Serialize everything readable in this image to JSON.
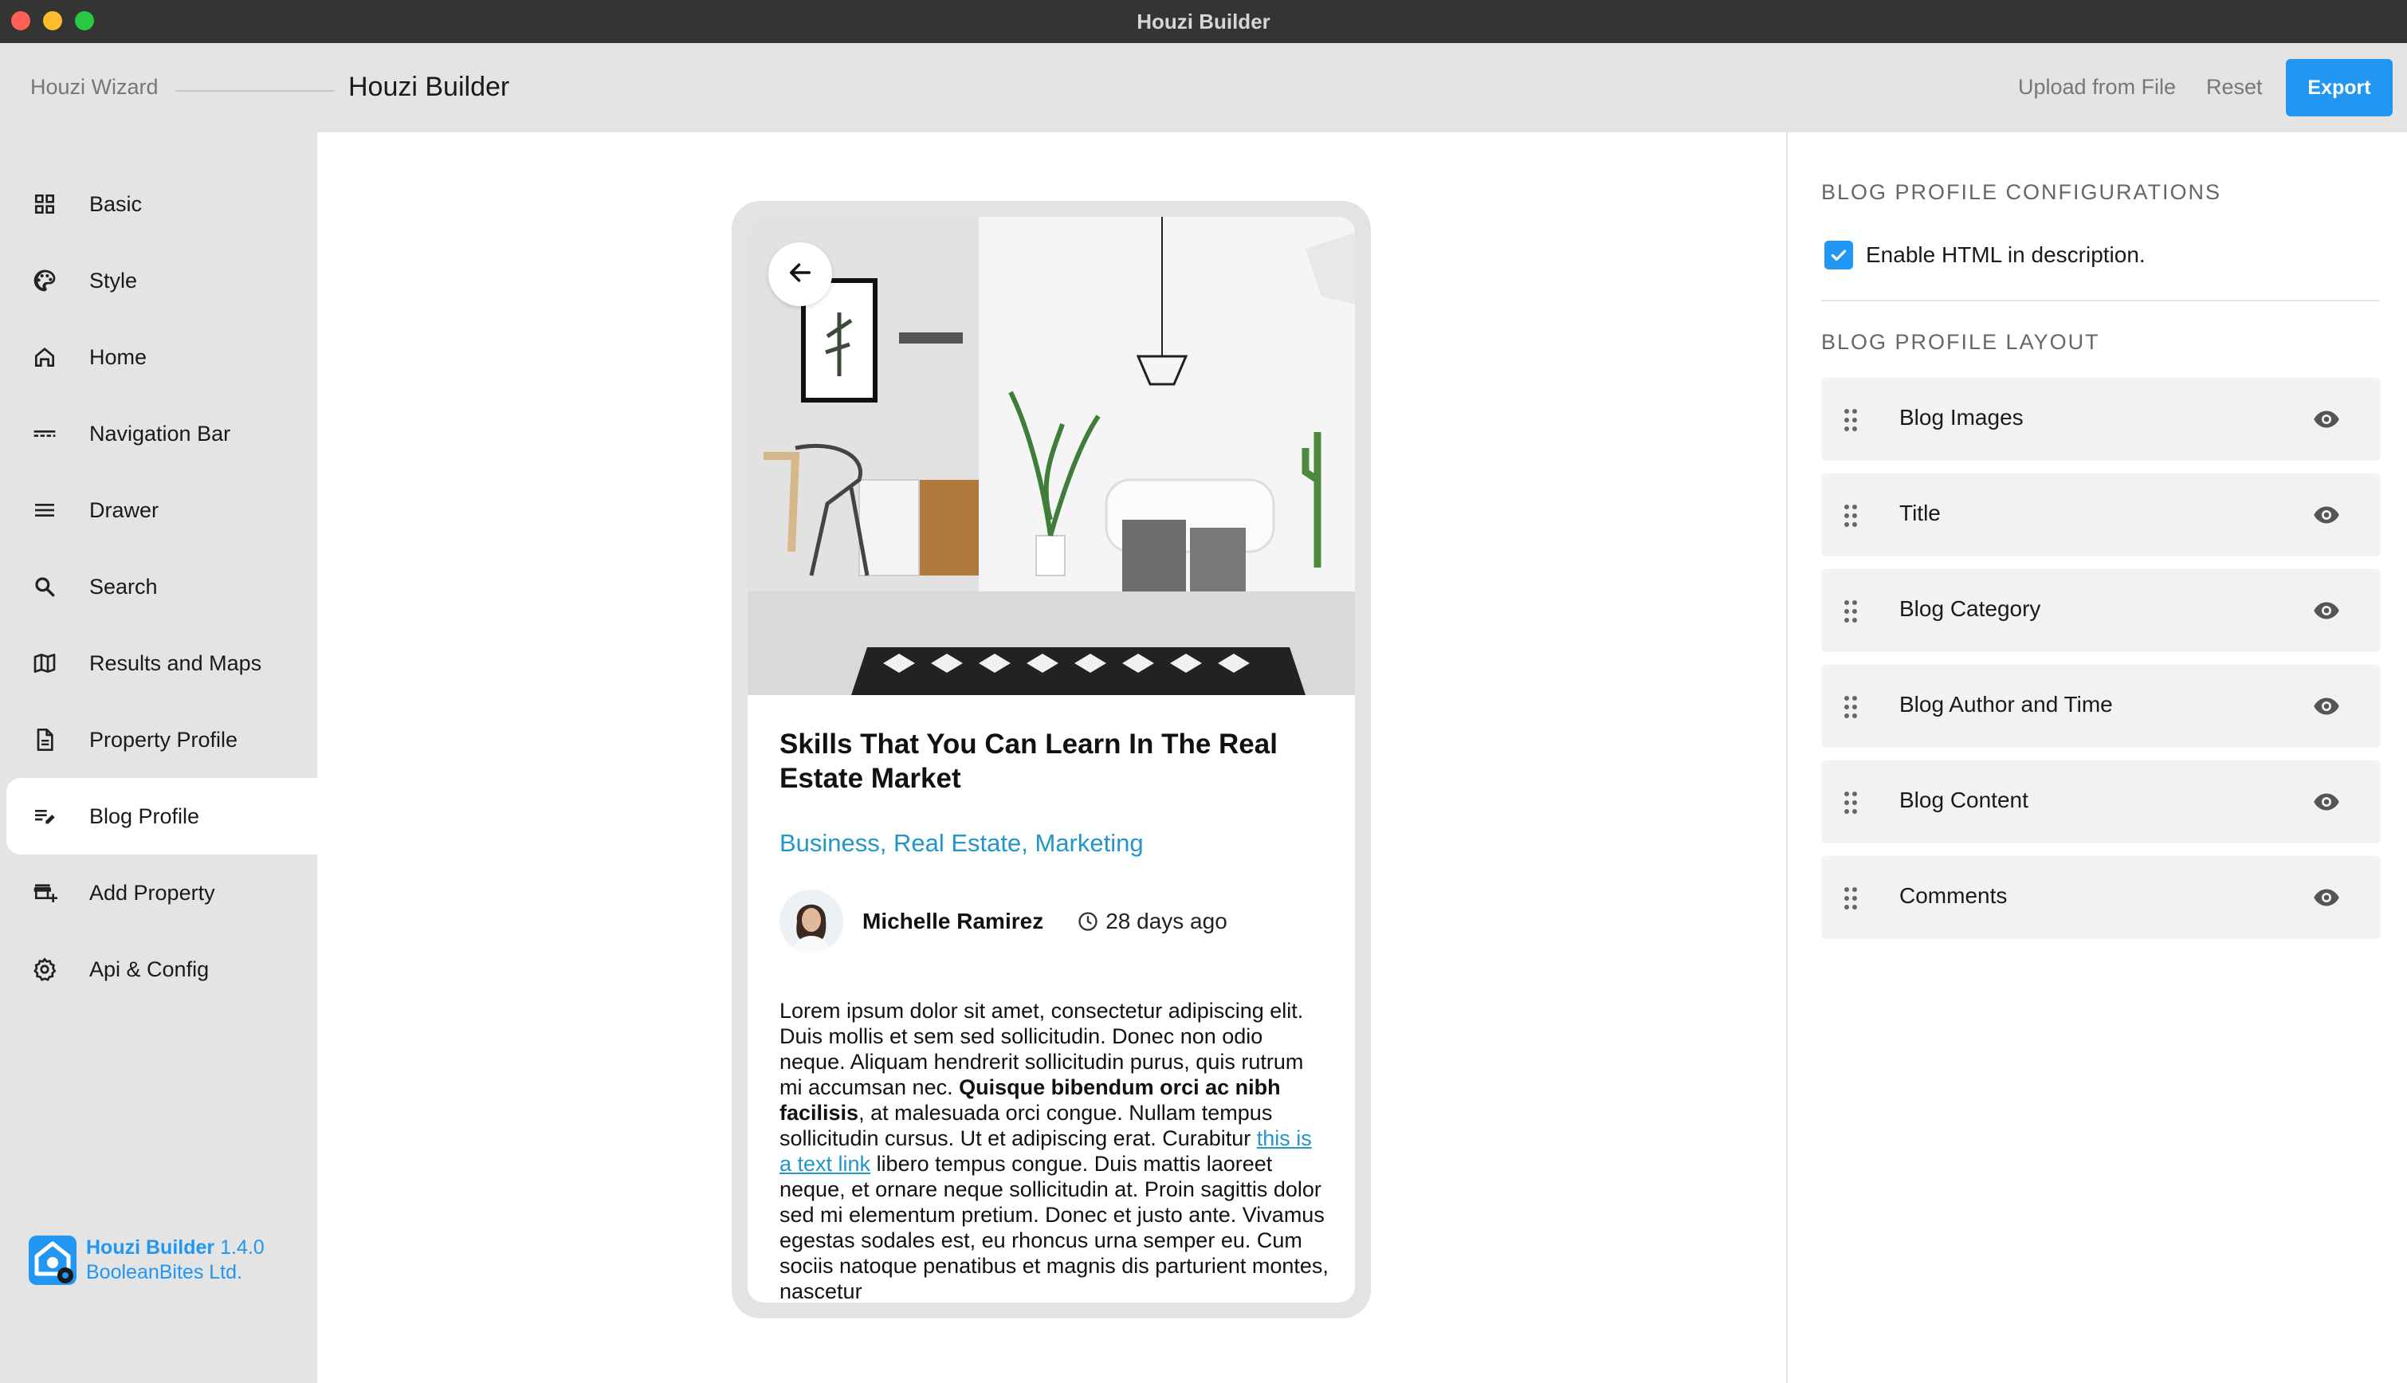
{
  "window": {
    "title": "Houzi Builder"
  },
  "header": {
    "crumb_wizard": "Houzi Wizard",
    "crumb_builder": "Houzi Builder",
    "upload_label": "Upload from File",
    "reset_label": "Reset",
    "export_label": "Export"
  },
  "sidebar": {
    "items": [
      {
        "label": "Basic",
        "icon": "grid-icon"
      },
      {
        "label": "Style",
        "icon": "palette-icon"
      },
      {
        "label": "Home",
        "icon": "home-icon"
      },
      {
        "label": "Navigation Bar",
        "icon": "navigation-bar-icon"
      },
      {
        "label": "Drawer",
        "icon": "menu-icon"
      },
      {
        "label": "Search",
        "icon": "search-icon"
      },
      {
        "label": "Results and Maps",
        "icon": "map-icon"
      },
      {
        "label": "Property Profile",
        "icon": "document-icon"
      },
      {
        "label": "Blog Profile",
        "icon": "edit-note-icon",
        "active": true
      },
      {
        "label": "Add Property",
        "icon": "add-business-icon"
      },
      {
        "label": "Api & Config",
        "icon": "gear-icon"
      }
    ],
    "brand": {
      "name": "Houzi Builder",
      "version": "1.4.0",
      "company": "BooleanBites Ltd."
    }
  },
  "preview": {
    "title": "Skills That You Can Learn In The Real Estate Market",
    "categories": "Business, Real Estate, Marketing",
    "author": "Michelle Ramirez",
    "time": "28 days ago",
    "body": {
      "p1": "Lorem ipsum dolor sit amet, consectetur adipiscing elit. Duis mollis et sem sed sollicitudin. Donec non odio neque. Aliquam hendrerit sollicitudin purus, quis rutrum mi accumsan nec. ",
      "bold": "Quisque bibendum orci ac nibh facilisis",
      "p2": ", at malesuada orci congue. Nullam tempus sollicitudin cursus. Ut et adipiscing erat. Curabitur ",
      "link": "this is a text link",
      "p3": " libero tempus congue. Duis mattis laoreet neque, et ornare neque sollicitudin at. Proin sagittis dolor sed mi elementum pretium. Donec et justo ante. Vivamus egestas sodales est, eu rhoncus urna semper eu. Cum sociis natoque penatibus et magnis dis parturient montes, nascetur"
    }
  },
  "config": {
    "heading": "BLOG PROFILE CONFIGURATIONS",
    "enable_html_label": "Enable HTML in description.",
    "enable_html_checked": true,
    "layout_heading": "BLOG PROFILE LAYOUT",
    "layout_items": [
      {
        "label": "Blog Images",
        "visible": true
      },
      {
        "label": "Title",
        "visible": true
      },
      {
        "label": "Blog Category",
        "visible": true
      },
      {
        "label": "Blog Author and Time",
        "visible": true
      },
      {
        "label": "Blog Content",
        "visible": true
      },
      {
        "label": "Comments",
        "visible": true
      }
    ]
  },
  "colors": {
    "accent": "#2196f3",
    "link": "#2196c9",
    "titlebar": "#343434"
  }
}
